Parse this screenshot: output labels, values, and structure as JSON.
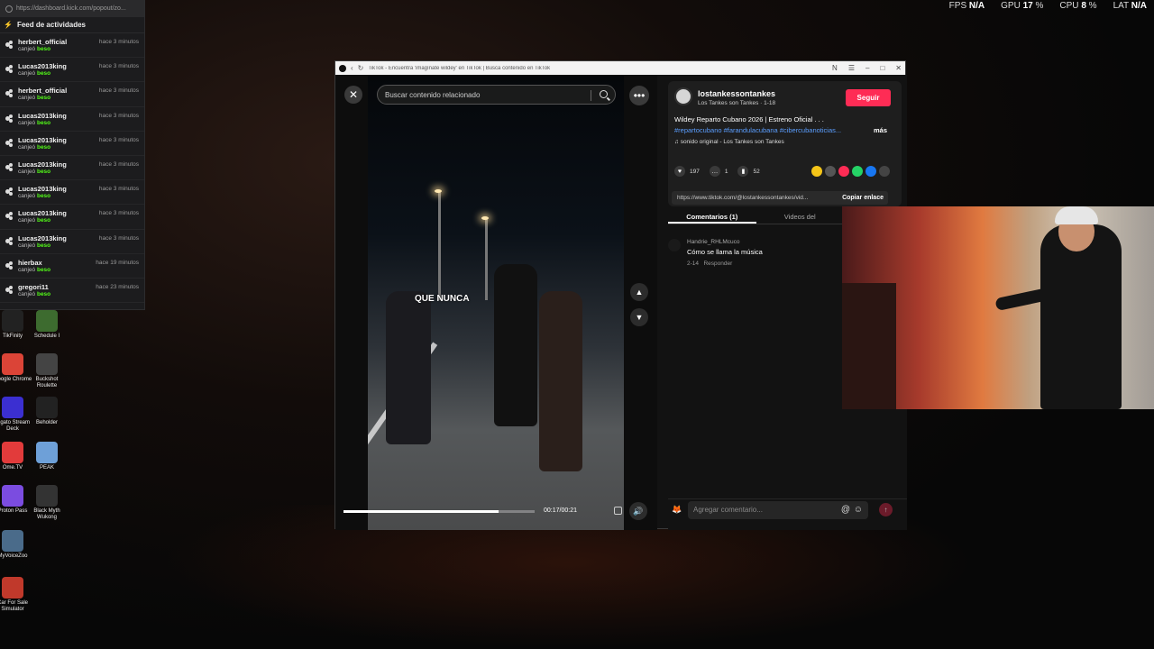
{
  "stats": {
    "fps_label": "FPS",
    "fps": "N/A",
    "gpu_label": "GPU",
    "gpu": "17",
    "gpu_unit": "%",
    "cpu_label": "CPU",
    "cpu": "8",
    "cpu_unit": "%",
    "lat_label": "LAT",
    "lat": "N/A"
  },
  "feed": {
    "url": "https://dashboard.kick.com/popout/zo...",
    "title": "Feed de actividades",
    "items": [
      {
        "user": "herbert_official",
        "action": "canjeó",
        "reward": "beso",
        "time": "hace 3 minutos"
      },
      {
        "user": "Lucas2013king",
        "action": "canjeó",
        "reward": "beso",
        "time": "hace 3 minutos"
      },
      {
        "user": "herbert_official",
        "action": "canjeó",
        "reward": "beso",
        "time": "hace 3 minutos"
      },
      {
        "user": "Lucas2013king",
        "action": "canjeó",
        "reward": "beso",
        "time": "hace 3 minutos"
      },
      {
        "user": "Lucas2013king",
        "action": "canjeó",
        "reward": "beso",
        "time": "hace 3 minutos"
      },
      {
        "user": "Lucas2013king",
        "action": "canjeó",
        "reward": "beso",
        "time": "hace 3 minutos"
      },
      {
        "user": "Lucas2013king",
        "action": "canjeó",
        "reward": "beso",
        "time": "hace 3 minutos"
      },
      {
        "user": "Lucas2013king",
        "action": "canjeó",
        "reward": "beso",
        "time": "hace 3 minutos"
      },
      {
        "user": "Lucas2013king",
        "action": "canjeó",
        "reward": "beso",
        "time": "hace 3 minutos"
      },
      {
        "user": "hierbax",
        "action": "canjeó",
        "reward": "beso",
        "time": "hace 19 minutos"
      },
      {
        "user": "gregori11",
        "action": "canjeó",
        "reward": "beso",
        "time": "hace 23 minutos"
      }
    ]
  },
  "desktop": [
    {
      "label": "TikFinity",
      "color": "#222"
    },
    {
      "label": "Schedule I",
      "color": "#3d6b2f"
    },
    {
      "label": "Google Chrome",
      "color": "#db4437"
    },
    {
      "label": "Buckshot Roulette",
      "color": "#444"
    },
    {
      "label": "Elgato Stream Deck",
      "color": "#3b2fd1"
    },
    {
      "label": "Beholder",
      "color": "#222"
    },
    {
      "label": "Ome.TV",
      "color": "#e23b3b"
    },
    {
      "label": "PEAK",
      "color": "#6ea0d8"
    },
    {
      "label": "Proton Pass",
      "color": "#7b4ce0"
    },
    {
      "label": "Black Myth Wukong",
      "color": "#333"
    },
    {
      "label": "MyVoiceZoo",
      "color": "#4a6b8a"
    },
    {
      "label": "Car For Sale Simulator",
      "color": "#c0392b"
    }
  ],
  "window": {
    "title": "TikTok - Encuentra 'imagínate wildey' en TikTok | Busca contenido en TikTok",
    "search_placeholder": "Buscar contenido relacionado",
    "caption": "QUE NUNCA",
    "progress": 0.81,
    "time": "00:17/00:21",
    "author": {
      "username": "lostankessontankes",
      "subtitle": "Los Tankes son Tankes · 1-18",
      "follow": "Seguir"
    },
    "description": "Wildey Reparto Cubano 2026 | Estreno Oficial . . .",
    "hashtags": "#repartocubano #farandulacubana #cibercubanoticias...",
    "more": "más",
    "sound": "sonido original - Los Tankes son Tankes",
    "likes": "197",
    "comments": "1",
    "saves": "52",
    "link": "https://www.tiktok.com/@lostankessontankes/vid...",
    "copy": "Copiar enlace",
    "tabs": [
      "Comentarios (1)",
      "Videos del"
    ],
    "comment": {
      "user": "Handrie_RHLMcuco",
      "text": "Cómo se llama la música",
      "date": "2-14",
      "reply": "Responder"
    },
    "comment_placeholder": "Agregar comentario..."
  }
}
